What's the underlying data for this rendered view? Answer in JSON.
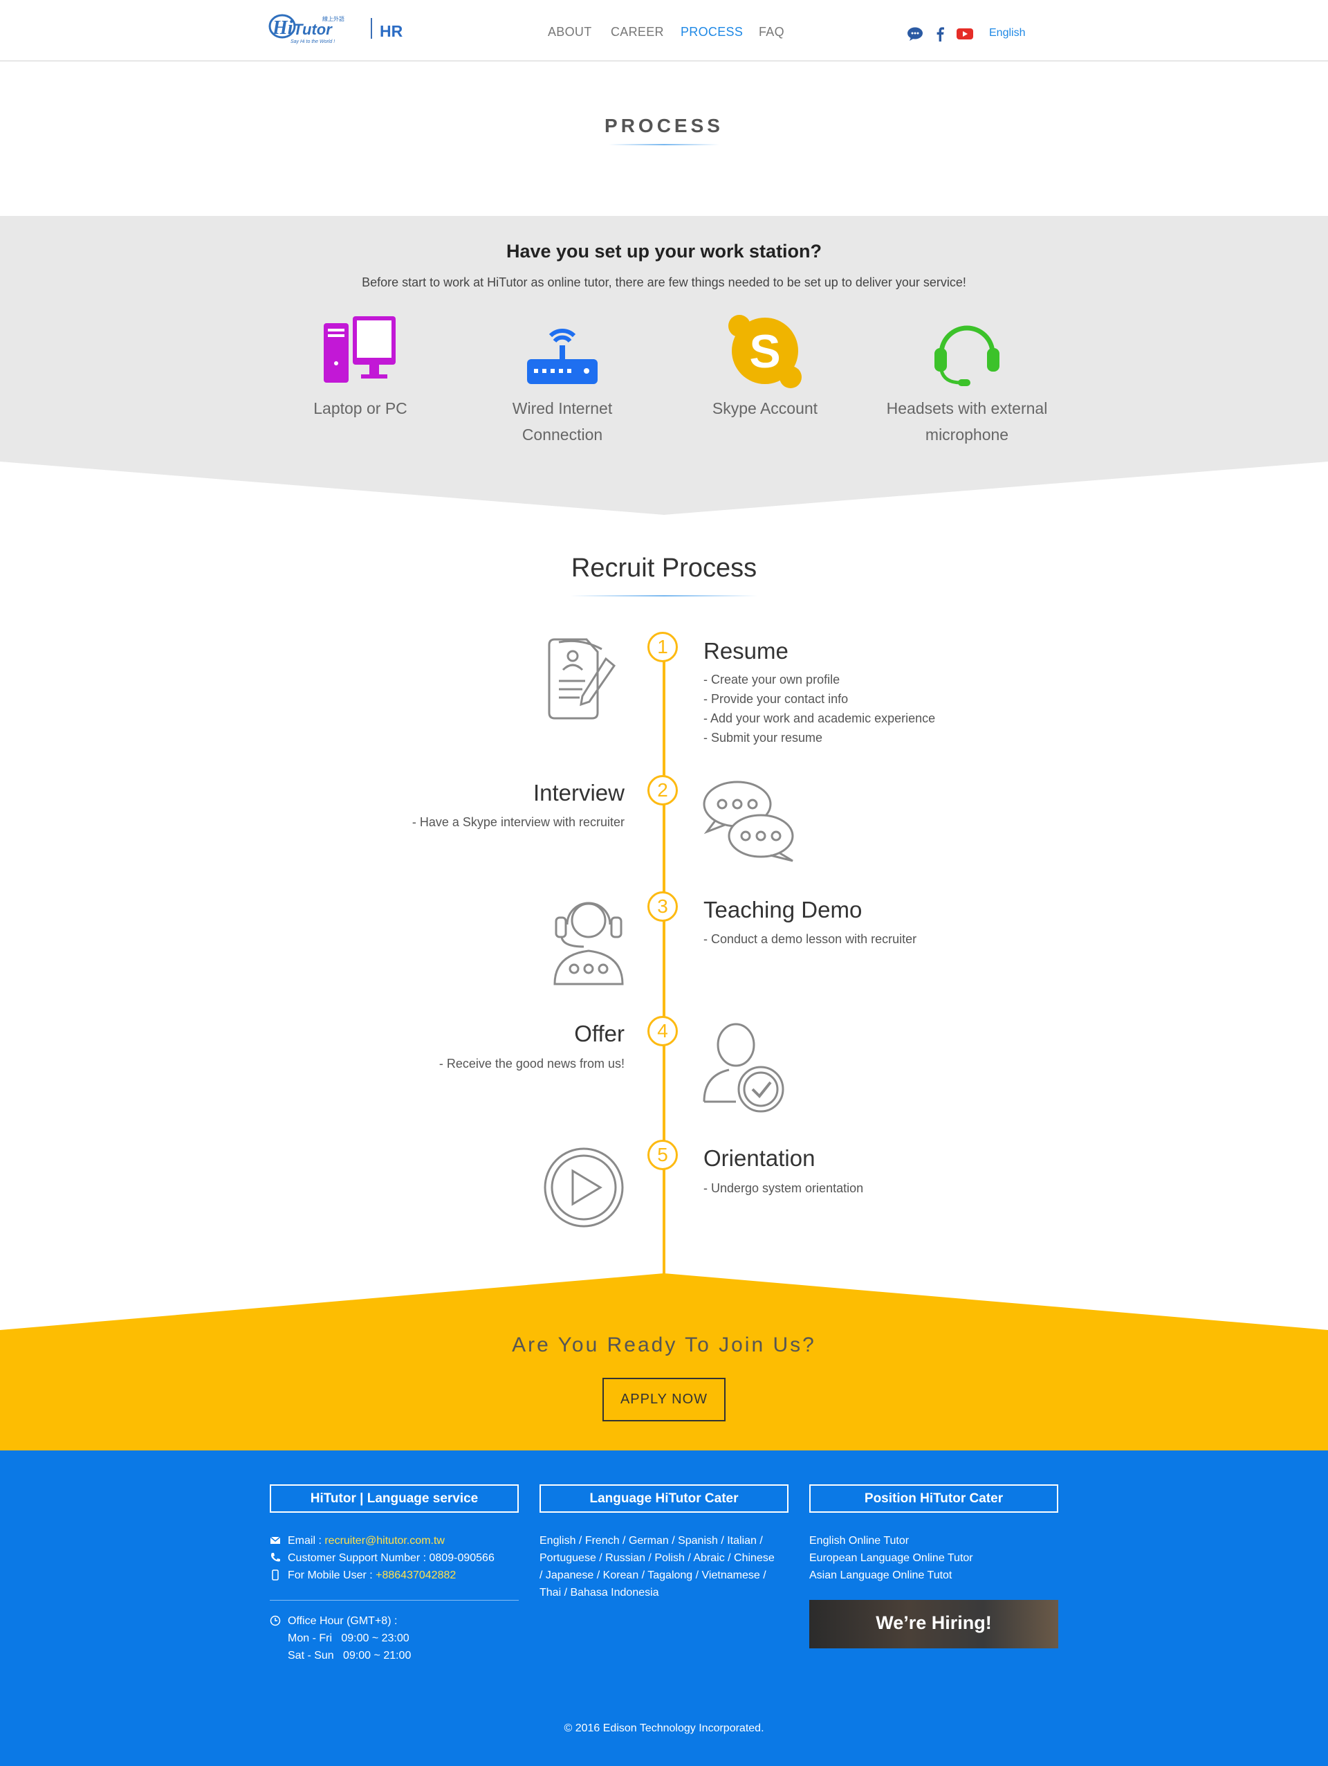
{
  "header": {
    "logo_text": "HiTutor",
    "logo_tagline": "線上外語家教",
    "logo_slogan": "Say Hi to the World !",
    "section_label": "HR",
    "nav": [
      "ABOUT",
      "CAREER",
      "PROCESS",
      "FAQ"
    ],
    "active_nav": "PROCESS",
    "social_icons": [
      "chat-icon",
      "facebook-icon",
      "youtube-icon"
    ],
    "language": "English"
  },
  "process_title": "PROCESS",
  "workstation": {
    "title": "Have you set up your work station?",
    "subtitle": "Before start to work at HiTutor as online tutor, there are few things needed to be set up to deliver your service!",
    "items": [
      {
        "label_line1": "Laptop or PC",
        "label_line2": "",
        "icon": "computer-icon",
        "color": "#c218d6"
      },
      {
        "label_line1": "Wired Internet",
        "label_line2": "Connection",
        "icon": "router-icon",
        "color": "#1e6ff0"
      },
      {
        "label_line1": "Skype Account",
        "label_line2": "",
        "icon": "skype-icon",
        "color": "#f0b400"
      },
      {
        "label_line1": "Headsets with external",
        "label_line2": "microphone",
        "icon": "headset-icon",
        "color": "#3cc22a"
      }
    ]
  },
  "recruit": {
    "title": "Recruit Process",
    "steps": [
      {
        "num": "1",
        "title": "Resume",
        "desc": [
          "- Create your own profile",
          "- Provide your contact info",
          "- Add your work and academic experience",
          "- Submit your resume"
        ]
      },
      {
        "num": "2",
        "title": "Interview",
        "desc": [
          "- Have a Skype interview with recruiter"
        ]
      },
      {
        "num": "3",
        "title": "Teaching Demo",
        "desc": [
          "- Conduct a demo lesson with recruiter"
        ]
      },
      {
        "num": "4",
        "title": "Offer",
        "desc": [
          "- Receive the good news from us!"
        ]
      },
      {
        "num": "5",
        "title": "Orientation",
        "desc": [
          "- Undergo system orientation"
        ]
      }
    ]
  },
  "join": {
    "title": "Are You Ready To Join Us?",
    "button": "APPLY NOW"
  },
  "footer": {
    "col1_title": "HiTutor | Language service",
    "email_label": "Email : ",
    "email": "recruiter@hitutor.com.tw",
    "support": "Customer Support Number : 0809-090566",
    "mobile_label": "For Mobile User : ",
    "mobile": "+886437042882",
    "office_hour": "Office Hour (GMT+8) :",
    "weekday": "Mon - Fri   09:00 ~ 23:00",
    "weekend": "Sat - Sun   09:00 ~ 21:00",
    "col2_title": "Language HiTutor Cater",
    "languages": [
      "English / French / German / Spanish / Italian /",
      "Portuguese / Russian / Polish / Abraic / Chinese",
      "/ Japanese / Korean / Tagalong / Vietnamese /",
      "Thai / Bahasa Indonesia"
    ],
    "col3_title": "Position HiTutor Cater",
    "positions": [
      "English Online Tutor",
      "European Language Online Tutor",
      "Asian Language Online Tutot"
    ],
    "hiring_banner": "We’re Hiring!",
    "copyright": "© 2016 Edison Technology Incorporated."
  },
  "colors": {
    "accent_blue": "#1e88e5",
    "timeline_yellow": "#fdba12",
    "join_yellow": "#fdbd02",
    "footer_blue": "#0b79e6",
    "workstation_gray": "#e8e8e8"
  }
}
